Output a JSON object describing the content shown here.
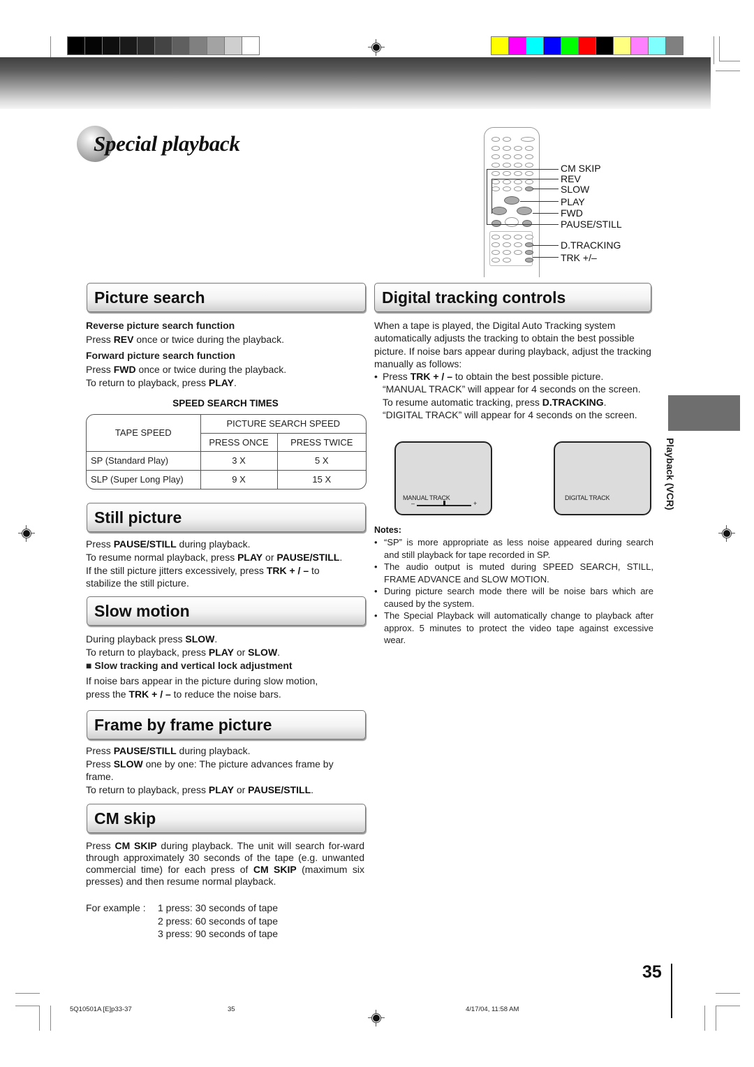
{
  "print_marks": {
    "grayscale_swatches": [
      "#000000",
      "#050505",
      "#0e0e0e",
      "#1a1a1a",
      "#2a2a2a",
      "#444444",
      "#5f5f5f",
      "#808080",
      "#a3a3a3",
      "#cfcfcf",
      "#ffffff"
    ],
    "color_swatches": [
      "#ffff00",
      "#ff00ff",
      "#00ffff",
      "#0000ff",
      "#00ff00",
      "#ff0000",
      "#000000",
      "#ffff80",
      "#ff80ff",
      "#80ffff",
      "#808080"
    ]
  },
  "page_title": "Special playback",
  "remote": {
    "labels": [
      "CM SKIP",
      "REV",
      "SLOW",
      "PLAY",
      "FWD",
      "PAUSE/STILL",
      "D.TRACKING",
      "TRK +/–"
    ]
  },
  "picture_search": {
    "heading": "Picture search",
    "reverse_title": "Reverse picture search function",
    "reverse_text": [
      "Press ",
      "REV",
      " once or twice during the playback."
    ],
    "forward_title": "Forward picture search function",
    "forward_text": [
      "Press ",
      "FWD",
      " once or twice during the playback."
    ],
    "return_text": [
      "To return to playback, press ",
      "PLAY",
      "."
    ],
    "table": {
      "title": "SPEED SEARCH TIMES",
      "col_tape_speed": "TAPE SPEED",
      "col_group": "PICTURE SEARCH SPEED",
      "col_once": "PRESS ONCE",
      "col_twice": "PRESS TWICE",
      "rows": [
        {
          "speed": "SP (Standard Play)",
          "once": "3 X",
          "twice": "5 X"
        },
        {
          "speed": "SLP (Super Long Play)",
          "once": "9 X",
          "twice": "15 X"
        }
      ]
    }
  },
  "still_picture": {
    "heading": "Still picture",
    "l1": [
      "Press ",
      "PAUSE/STILL",
      " during playback."
    ],
    "l2": [
      "To resume normal playback, press ",
      "PLAY",
      " or ",
      "PAUSE/STILL",
      "."
    ],
    "l3": [
      "If the still picture jitters excessively, press ",
      "TRK + / –",
      " to"
    ],
    "l4": "stabilize the still picture."
  },
  "slow_motion": {
    "heading": "Slow motion",
    "l1": [
      "During playback press ",
      "SLOW",
      "."
    ],
    "l2": [
      "To return to playback, press ",
      "PLAY",
      " or ",
      "SLOW",
      "."
    ],
    "sub_title": "Slow tracking and vertical lock adjustment",
    "l3": "If noise bars appear in the picture during slow motion,",
    "l4": [
      "press the ",
      "TRK + / –",
      " to reduce the noise bars."
    ]
  },
  "frame_by_frame": {
    "heading": "Frame by frame picture",
    "l1": [
      "Press ",
      "PAUSE/STILL",
      " during playback."
    ],
    "l2": [
      "Press ",
      "SLOW",
      " one by one: The picture advances frame by"
    ],
    "l3": "frame.",
    "l4": [
      "To return to playback, press ",
      "PLAY",
      " or ",
      "PAUSE/STILL",
      "."
    ]
  },
  "cm_skip": {
    "heading": "CM skip",
    "p1": [
      "Press ",
      "CM SKIP",
      " during playback. The unit will search for-ward through approximately 30 seconds of the tape (e.g. unwanted commercial time) for each press of ",
      "CM SKIP",
      " (maximum six presses) and then resume normal playback."
    ],
    "example_label": "For example :",
    "examples": [
      "1 press: 30 seconds of tape",
      "2 press: 60 seconds of tape",
      "3 press: 90 seconds of tape"
    ]
  },
  "digital_tracking": {
    "heading": "Digital tracking controls",
    "intro": "When a tape is played, the Digital Auto Tracking system automatically adjusts the tracking to obtain the best possible picture. If noise bars appear during playback, adjust the tracking manually as follows:",
    "bullet": [
      "Press ",
      "TRK + / –",
      " to obtain the best possible picture. “MANUAL TRACK” will appear for 4 seconds on the screen. To resume automatic tracking, press ",
      "D.TRACKING",
      ". “DIGITAL TRACK” will appear for 4 seconds on the screen."
    ],
    "screen_manual": {
      "label": "MANUAL  TRACK",
      "minus": "–",
      "plus": "+",
      "level": 0.5
    },
    "screen_digital": {
      "label": "DIGITAL TRACK"
    }
  },
  "notes": {
    "title": "Notes:",
    "items": [
      "“SP” is more appropriate as less noise appeared during search and still playback for tape recorded in SP.",
      "The audio output is muted during SPEED SEARCH, STILL, FRAME ADVANCE and SLOW MOTION.",
      "During picture search mode there will be noise bars which are caused by the system.",
      "The Special Playback will automatically change to playback after approx. 5 minutes to protect the video tape against excessive wear."
    ]
  },
  "side_tab_label": "Playback (VCR)",
  "page_number": "35",
  "footer": {
    "file": "5Q10501A [E]p33-37",
    "page": "35",
    "timestamp": "4/17/04, 11:58 AM"
  }
}
